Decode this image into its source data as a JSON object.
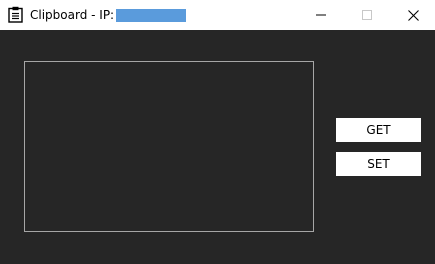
{
  "window": {
    "title": "Clipboard - IP:",
    "icon": "clipboard-icon",
    "ip_redaction_color": "#5a9bdc",
    "background_color": "#262626",
    "titlebar_color": "#ffffff"
  },
  "titlebar_controls": {
    "minimize_icon": "minimize-icon",
    "maximize_icon": "maximize-icon",
    "close_icon": "close-icon"
  },
  "main": {
    "clipboard_text": "",
    "textbox_border_color": "#a6a6a6",
    "get_label": "GET",
    "set_label": "SET"
  }
}
